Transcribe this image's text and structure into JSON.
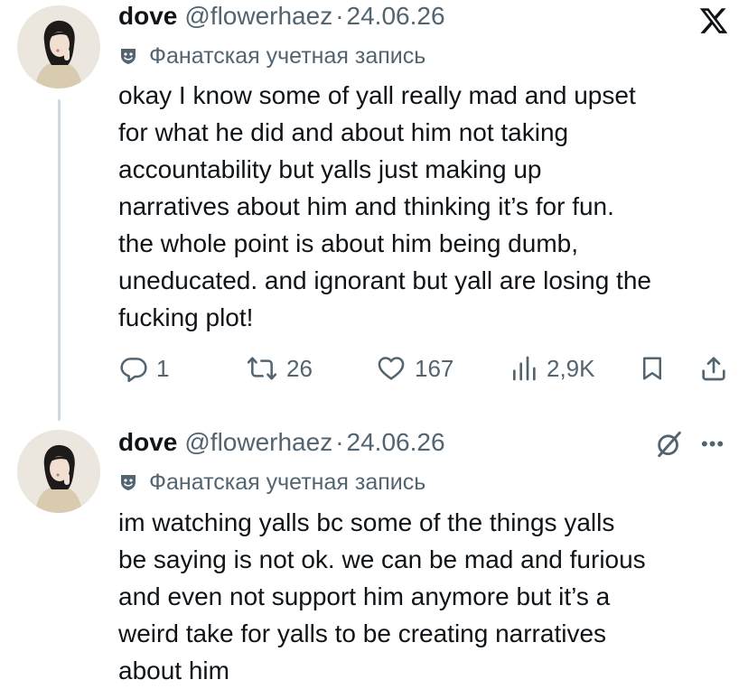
{
  "tweets": [
    {
      "author": {
        "name": "dove",
        "handle": "@flowerhaez",
        "separator": "·",
        "date": "24.06.26",
        "badge": "Фанатская учетная запись",
        "avatar_icon": "profile-photo"
      },
      "text": "okay I know some of yall really mad and upset\nfor what he did and about him not taking\naccountability but yalls just making up\nnarratives about him and thinking it’s for fun.\nthe whole point is about him being dumb,\nuneducated. and ignorant but yall are losing the\nfucking plot!",
      "actions": {
        "replies": "1",
        "reposts": "26",
        "likes": "167",
        "views": "2,9K"
      }
    },
    {
      "author": {
        "name": "dove",
        "handle": "@flowerhaez",
        "separator": "·",
        "date": "24.06.26",
        "badge": "Фанатская учетная запись",
        "avatar_icon": "profile-photo"
      },
      "text": "im watching yalls bc some of the things yalls\nbe saying is not ok. we can be mad and furious\nand even not support him anymore but it’s a\nweird take for yalls to be creating narratives\nabout him"
    }
  ],
  "icons": {
    "brand": "x-logo-icon",
    "reply": "reply-icon",
    "repost": "repost-icon",
    "like": "heart-icon",
    "views": "views-icon",
    "bookmark": "bookmark-icon",
    "share": "share-icon",
    "grok": "grok-icon",
    "more": "more-icon"
  },
  "colors": {
    "text": "#0f1419",
    "secondary": "#536471",
    "thread_line": "#cfd9de"
  }
}
